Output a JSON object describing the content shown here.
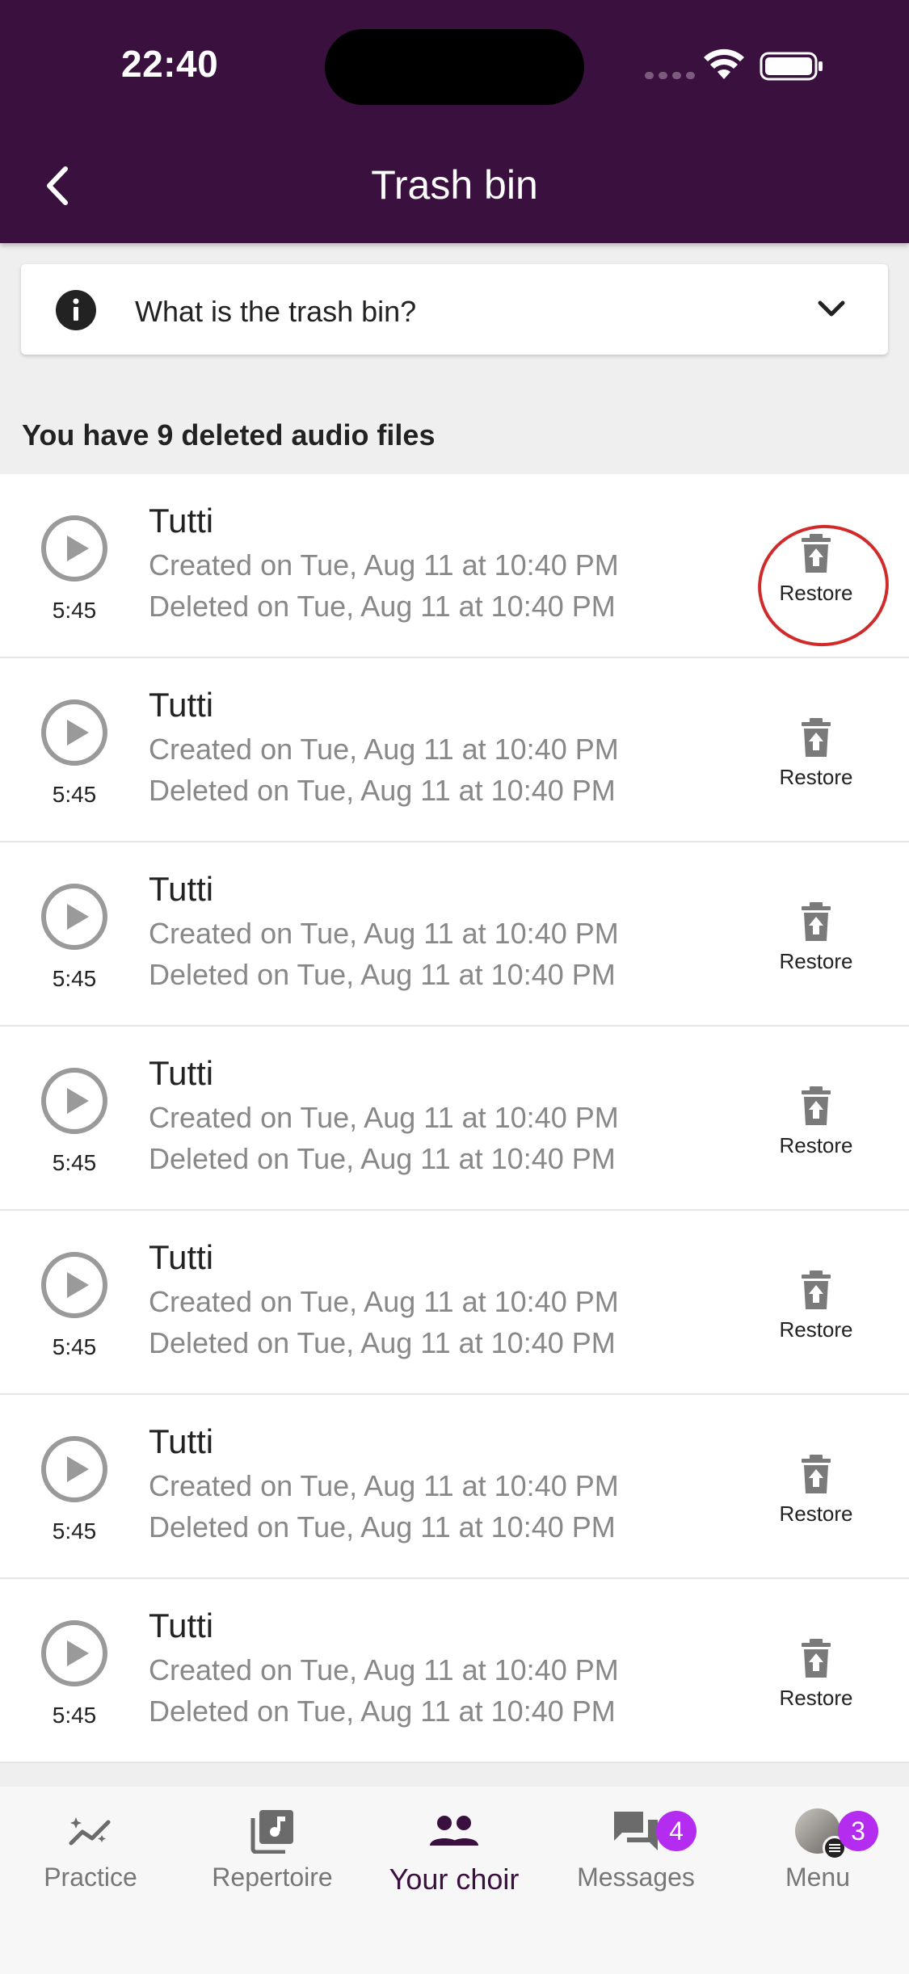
{
  "status_bar": {
    "time": "22:40"
  },
  "header": {
    "title": "Trash bin"
  },
  "info": {
    "question": "What is the trash bin?"
  },
  "summary": {
    "count_text": "You have 9 deleted audio files"
  },
  "files": [
    {
      "title": "Tutti",
      "duration": "5:45",
      "created": "Created on Tue, Aug 11 at 10:40 PM",
      "deleted": "Deleted on Tue, Aug 11 at 10:40 PM",
      "restore_label": "Restore"
    },
    {
      "title": "Tutti",
      "duration": "5:45",
      "created": "Created on Tue, Aug 11 at 10:40 PM",
      "deleted": "Deleted on Tue, Aug 11 at 10:40 PM",
      "restore_label": "Restore"
    },
    {
      "title": "Tutti",
      "duration": "5:45",
      "created": "Created on Tue, Aug 11 at 10:40 PM",
      "deleted": "Deleted on Tue, Aug 11 at 10:40 PM",
      "restore_label": "Restore"
    },
    {
      "title": "Tutti",
      "duration": "5:45",
      "created": "Created on Tue, Aug 11 at 10:40 PM",
      "deleted": "Deleted on Tue, Aug 11 at 10:40 PM",
      "restore_label": "Restore"
    },
    {
      "title": "Tutti",
      "duration": "5:45",
      "created": "Created on Tue, Aug 11 at 10:40 PM",
      "deleted": "Deleted on Tue, Aug 11 at 10:40 PM",
      "restore_label": "Restore"
    },
    {
      "title": "Tutti",
      "duration": "5:45",
      "created": "Created on Tue, Aug 11 at 10:40 PM",
      "deleted": "Deleted on Tue, Aug 11 at 10:40 PM",
      "restore_label": "Restore"
    },
    {
      "title": "Tutti",
      "duration": "5:45",
      "created": "Created on Tue, Aug 11 at 10:40 PM",
      "deleted": "Deleted on Tue, Aug 11 at 10:40 PM",
      "restore_label": "Restore"
    }
  ],
  "nav": {
    "practice": "Practice",
    "repertoire": "Repertoire",
    "your_choir": "Your choir",
    "messages": "Messages",
    "messages_badge": "4",
    "menu": "Menu",
    "menu_badge": "3"
  },
  "colors": {
    "header": "#3a103e",
    "badge": "#b32cf0",
    "highlight": "#d12a2a"
  }
}
